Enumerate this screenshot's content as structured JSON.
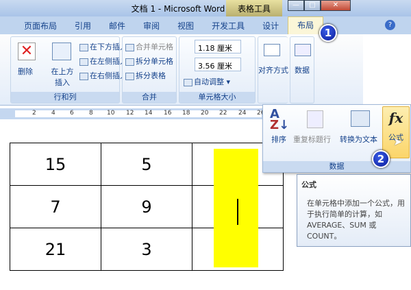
{
  "window": {
    "title": "文档 1 - Microsoft Word",
    "context_tab": "表格工具",
    "min": "—",
    "max": "□",
    "close": "✕"
  },
  "tabs": [
    {
      "label": "页面布局"
    },
    {
      "label": "引用"
    },
    {
      "label": "邮件"
    },
    {
      "label": "审阅"
    },
    {
      "label": "视图"
    },
    {
      "label": "开发工具"
    },
    {
      "label": "设计"
    },
    {
      "label": "布局",
      "active": true
    }
  ],
  "help": "?",
  "ribbon": {
    "rows_cols": {
      "label": "行和列",
      "delete": "删除",
      "insert_above": "在上方插入",
      "insert_below": "在下方插入",
      "insert_left": "在左侧插入",
      "insert_right": "在右侧插入"
    },
    "merge": {
      "label": "合并",
      "merge_cells": "合并单元格",
      "split_cells": "拆分单元格",
      "split_table": "拆分表格"
    },
    "cell_size": {
      "label": "单元格大小",
      "height": "1.18 厘米",
      "width": "3.56 厘米",
      "autofit": "自动调整"
    },
    "align": {
      "label": "对齐方式"
    },
    "data": {
      "label": "数据"
    }
  },
  "ruler": [
    "2",
    "4",
    "6",
    "8",
    "10",
    "12",
    "14",
    "16",
    "18",
    "20",
    "22",
    "24",
    "26"
  ],
  "data_panel": {
    "label": "数据",
    "sort": "排序",
    "repeat_header": "重复标题行",
    "convert_to_text": "转换为文本",
    "formula": "公式"
  },
  "badges": [
    "1",
    "2"
  ],
  "tooltip": {
    "title": "公式",
    "body": "在单元格中添加一个公式，用于执行简单的计算，如 AVERAGE、SUM 或 COUNT。"
  },
  "table": [
    [
      "15",
      "5",
      ""
    ],
    [
      "7",
      "9",
      ""
    ],
    [
      "21",
      "3",
      ""
    ]
  ],
  "colors": {
    "highlight": "#ffff00",
    "formula_button": "#fbd56a"
  }
}
